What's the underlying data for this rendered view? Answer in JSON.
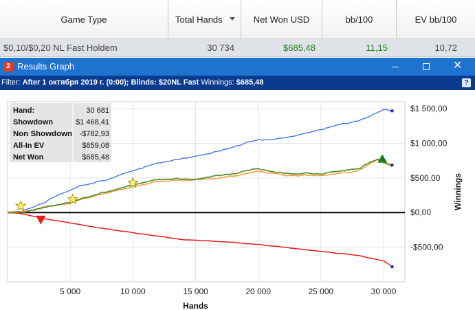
{
  "table": {
    "columns": [
      {
        "label": "Game Type"
      },
      {
        "label": "Total Hands"
      },
      {
        "label": "Net Won USD"
      },
      {
        "label": "bb/100"
      },
      {
        "label": "EV bb/100"
      }
    ],
    "row": {
      "game_type": "$0,10/$0,20 NL Fast Holdem",
      "total_hands": "30 734",
      "net_won": "$685,48",
      "bb100": "11,15",
      "ev_bb100": "10,72"
    }
  },
  "window": {
    "icon_text": "2",
    "title": "Results Graph",
    "filter_label": "Filter:",
    "filter_value": "After 1 октября 2019 г. (0:00); Blinds: $20NL Fast",
    "winnings_label": "Winnings:",
    "winnings_value": "$685,48",
    "help_symbol": "?",
    "close_symbol": "✕"
  },
  "colors": {
    "titlebar": "#1e73cf",
    "filterbar": "#0b3b8f",
    "net_won_green": "#1a7f1a",
    "showdown": "#3a6fe0",
    "non_showdown": "#e31b1b",
    "all_in_ev": "#f5a040",
    "net_won_line": "#4f8a2a"
  },
  "stats": [
    {
      "label": "Hand:",
      "value": "30 681"
    },
    {
      "label": "Showdown",
      "value": "$1 468,41"
    },
    {
      "label": "Non Showdown",
      "value": "-$782,93"
    },
    {
      "label": "All-In EV",
      "value": "$659,08"
    },
    {
      "label": "Net Won",
      "value": "$685,48"
    }
  ],
  "chart_data": {
    "type": "line",
    "xlabel": "Hands",
    "ylabel": "Winnings",
    "xlim": [
      0,
      31700
    ],
    "ylim": [
      -1000,
      1600
    ],
    "x_ticks": [
      5000,
      10000,
      15000,
      20000,
      25000,
      30000
    ],
    "x_tick_labels": [
      "5 000",
      "10 000",
      "15 000",
      "20 000",
      "25 000",
      "30 000"
    ],
    "y_ticks": [
      1500,
      1000,
      500,
      0,
      -500
    ],
    "y_tick_labels": [
      "$1 500,00",
      "$1 000,00",
      "$500,00",
      "$0,00",
      "-$500,00"
    ],
    "grid": true,
    "series": [
      {
        "name": "Showdown",
        "x": [
          0,
          1000,
          2000,
          3000,
          4000,
          5000,
          6000,
          8000,
          10000,
          12000,
          14000,
          16000,
          18000,
          20000,
          22000,
          24000,
          26000,
          28000,
          30000,
          30681
        ],
        "y": [
          0,
          20,
          80,
          150,
          250,
          320,
          400,
          480,
          600,
          720,
          780,
          850,
          950,
          1050,
          1080,
          1150,
          1250,
          1320,
          1480,
          1468
        ]
      },
      {
        "name": "Non Showdown",
        "x": [
          0,
          1000,
          2000,
          3000,
          5000,
          8000,
          10000,
          14000,
          18000,
          20000,
          24000,
          28000,
          30000,
          30681
        ],
        "y": [
          0,
          -10,
          -50,
          -90,
          -150,
          -240,
          -290,
          -390,
          -430,
          -460,
          -540,
          -620,
          -700,
          -783
        ]
      },
      {
        "name": "All-In EV",
        "x": [
          0,
          1000,
          2000,
          3000,
          5000,
          7000,
          10000,
          12000,
          15000,
          18000,
          20000,
          22000,
          25000,
          28000,
          29500,
          30681
        ],
        "y": [
          0,
          10,
          40,
          80,
          140,
          240,
          370,
          450,
          470,
          520,
          600,
          530,
          540,
          600,
          760,
          659
        ]
      },
      {
        "name": "Net Won",
        "x": [
          0,
          1000,
          2000,
          3000,
          5000,
          7000,
          10000,
          12000,
          15000,
          18000,
          20000,
          22000,
          25000,
          28000,
          29500,
          30681
        ],
        "y": [
          0,
          5,
          30,
          70,
          150,
          260,
          400,
          490,
          480,
          560,
          640,
          560,
          560,
          640,
          780,
          685
        ]
      }
    ]
  }
}
